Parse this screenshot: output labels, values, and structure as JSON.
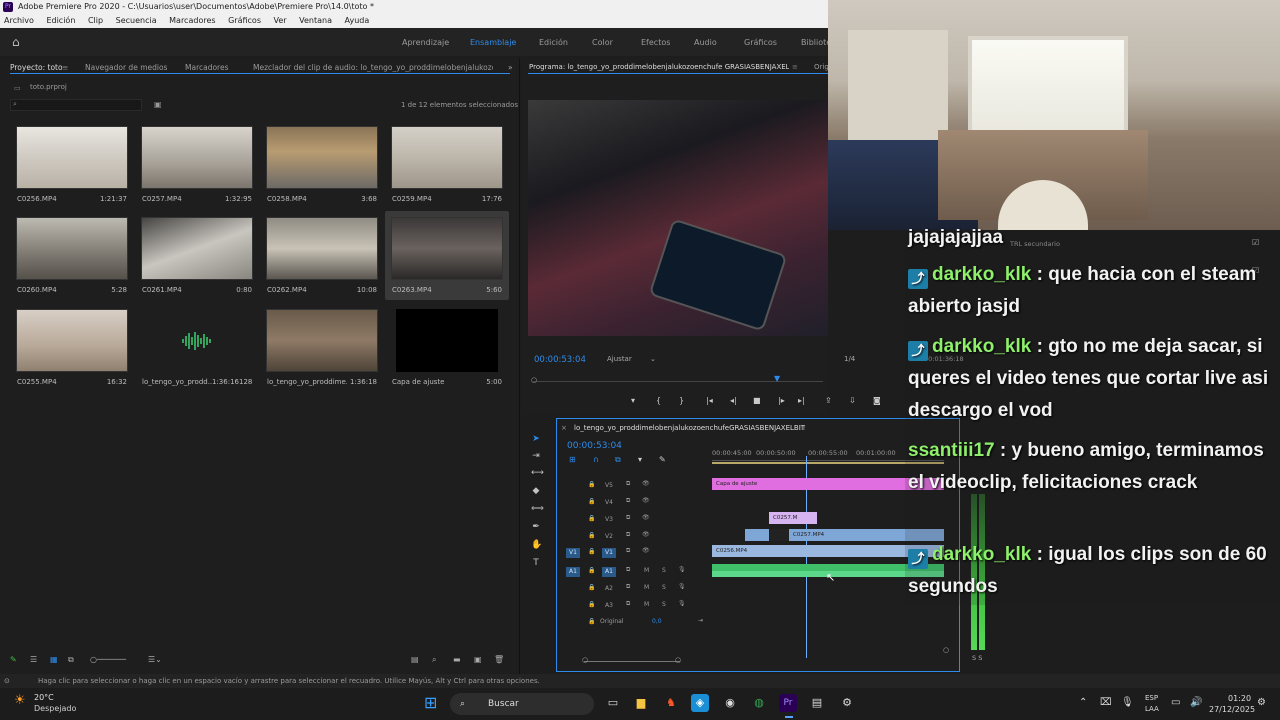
{
  "app": {
    "title": "Adobe Premiere Pro 2020 - C:\\Usuarios\\user\\Documentos\\Adobe\\Premiere Pro\\14.0\\toto *",
    "logo": "Pr"
  },
  "menu": [
    "Archivo",
    "Edición",
    "Clip",
    "Secuencia",
    "Marcadores",
    "Gráficos",
    "Ver",
    "Ventana",
    "Ayuda"
  ],
  "workspaces": {
    "items": [
      "Aprendizaje",
      "Ensamblaje",
      "Edición",
      "Color",
      "Efectos",
      "Audio",
      "Gráficos",
      "Bibliote"
    ],
    "active": "Ensamblaje"
  },
  "project_panel": {
    "tabs": [
      "Proyecto: toto",
      "Navegador de medios",
      "Marcadores",
      "Mezclador del clip de audio: lo_tengo_yo_proddimelobenjalukozoenchufe"
    ],
    "file": "toto.prproj",
    "selection_info": "1 de 12 elementos seleccionados",
    "clips": [
      {
        "name": "C0256.MP4",
        "duration": "1:21:37"
      },
      {
        "name": "C0257.MP4",
        "duration": "1:32:95"
      },
      {
        "name": "C0258.MP4",
        "duration": "3:68"
      },
      {
        "name": "C0259.MP4",
        "duration": "17:76"
      },
      {
        "name": "C0260.MP4",
        "duration": "5:28"
      },
      {
        "name": "C0261.MP4",
        "duration": "0:80"
      },
      {
        "name": "C0262.MP4",
        "duration": "10:08"
      },
      {
        "name": "C0263.MP4",
        "duration": "5:60"
      },
      {
        "name": "C0255.MP4",
        "duration": "16:32"
      },
      {
        "name": "lo_tengo_yo_prodd...",
        "duration": "1:36:16128"
      },
      {
        "name": "lo_tengo_yo_proddime...",
        "duration": "1:36:18"
      },
      {
        "name": "Capa de ajuste",
        "duration": "5:00"
      }
    ]
  },
  "program_monitor": {
    "tab": "Programa: lo_tengo_yo_proddimelobenjalukozoenchufe GRASIASBENJAXELBIT",
    "timecode": "00:00:53:04",
    "fit": "Ajustar",
    "resolution": "1/4",
    "tab_extra": "Orig"
  },
  "timeline": {
    "tab": "lo_tengo_yo_proddimelobenjalukozoenchufeGRASIASBENJAXELBIT",
    "timecode": "00:00:53:04",
    "ruler": [
      "00:00:45:00",
      "00:00:50:00",
      "00:00:55:00",
      "00:01:00:00"
    ],
    "video_tracks": [
      "V5",
      "V4",
      "V3",
      "V2",
      "V1"
    ],
    "audio_tracks": [
      "A1",
      "A2",
      "A3"
    ],
    "source_v": "V1",
    "source_a": "A1",
    "master": "Original",
    "master_value": "0,0",
    "clips": {
      "v5": "Capa de ajuste",
      "v3": "C0257.M",
      "v2": "C0257.MP4",
      "v1": "C0256.MP4"
    },
    "audio_flags": {
      "m": "M",
      "s": "S"
    },
    "meter_labels": "S S"
  },
  "chat": {
    "lines": [
      {
        "user": "",
        "text": "jajajajajjaa"
      },
      {
        "user": "darkko_klk",
        "text": "que hacia con el steam abierto jasjd"
      },
      {
        "user": "darkko_klk",
        "text": "gto no me deja sacar, si queres el video tenes que cortar live asi descargo el vod"
      },
      {
        "user": "ssantiii17",
        "text": "y bueno amigo, terminamos el videoclip, felicitaciones crack"
      },
      {
        "user": "darkko_klk",
        "text": "igual los clips son de 60 segundos"
      }
    ],
    "overlay_label": "TRL secundario",
    "overlay_time": "00:01:36:18"
  },
  "status_bar": {
    "text": "Haga clic para seleccionar o haga clic en un espacio vacío y arrastre para seleccionar el recuadro. Utilice Mayús, Alt y Ctrl para otras opciones."
  },
  "taskbar": {
    "weather_temp": "20°C",
    "weather_desc": "Despejado",
    "search_label": "Buscar",
    "lang": "ESP",
    "lang2": "LAA",
    "time": "01:20",
    "date": "27/12/2025"
  },
  "colors": {
    "accent": "#2d8ceb",
    "v5_clip": "#e06ee0",
    "v3_clip": "#d6b4f0",
    "v2_clip": "#7ea6d6",
    "v1_clip": "#9ab7e0",
    "audio_clip": "#3fbf6a",
    "chat_user": "#8ef06a"
  }
}
